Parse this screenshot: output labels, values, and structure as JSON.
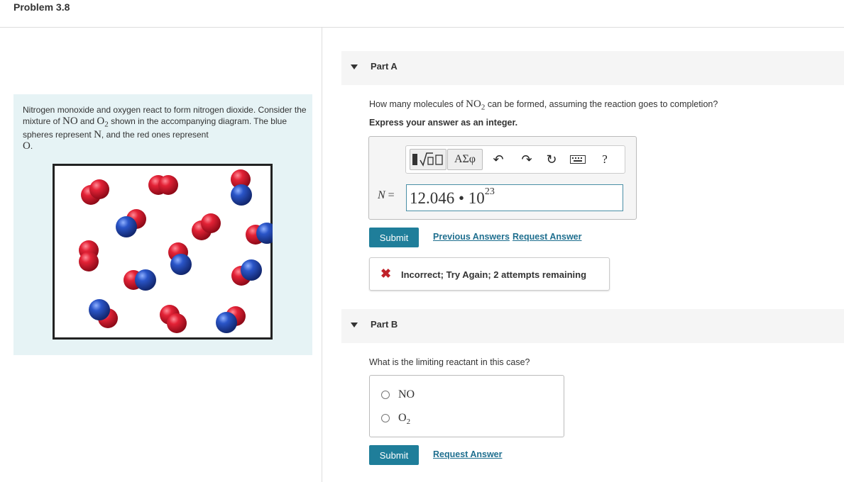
{
  "page_title": "Problem 3.8",
  "problem": {
    "text_1": "Nitrogen monoxide and oxygen react to form nitrogen dioxide. Consider the mixture of ",
    "no_formula": "NO",
    "text_2": " and ",
    "o2_formula": "O",
    "o2_sub": "2",
    "text_3": " shown in the accompanying diagram. The blue spheres represent ",
    "n_symbol": "N",
    "text_4": ", and the red ones represent ",
    "o_symbol": "O",
    "text_5": "."
  },
  "part_a": {
    "label": "Part A",
    "question_1": "How many molecules of ",
    "question_formula": "NO",
    "question_sub": "2",
    "question_2": " can be formed, assuming the reaction goes to completion?",
    "instruction": "Express your answer as an integer.",
    "toolbar": {
      "templates_icon": "fraction-sqrt-template-icon",
      "symbols_label": "ΑΣφ",
      "undo_icon": "undo-icon",
      "redo_icon": "redo-icon",
      "reset_icon": "reset-icon",
      "keyboard_icon": "keyboard-icon",
      "help_label": "?"
    },
    "variable": "N",
    "equals": " =",
    "answer_mantissa": "12.046 • 10",
    "answer_exponent": "23",
    "submit_label": "Submit",
    "previous_answers_label": "Previous Answers",
    "request_answer_label": "Request Answer",
    "feedback_icon": "✖",
    "feedback_text": "Incorrect; Try Again; 2 attempts remaining"
  },
  "part_b": {
    "label": "Part B",
    "question": "What is the limiting reactant in this case?",
    "options": [
      {
        "label": "NO",
        "sub": ""
      },
      {
        "label": "O",
        "sub": "2"
      }
    ],
    "submit_label": "Submit",
    "request_answer_label": "Request Answer"
  },
  "colors": {
    "accent": "#1f7e9a",
    "link": "#1f6f8f",
    "panel_bg": "#e6f3f5",
    "nitrogen_blue": "#2a4fa8",
    "oxygen_red": "#c8152a",
    "error_red": "#c0222a"
  }
}
